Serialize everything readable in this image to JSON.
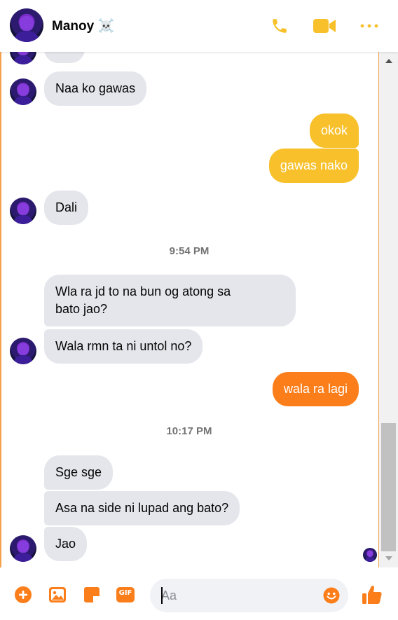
{
  "header": {
    "name": "Manoy ☠️",
    "call_icon": "phone-icon",
    "video_icon": "video-camera-icon",
    "more_icon": "more-options-icon"
  },
  "colors": {
    "accent_yellow": "#f8c02a",
    "accent_orange": "#fb7e1a",
    "incoming_bubble": "#e4e6eb"
  },
  "messages": {
    "m1": "Naa ko gawas",
    "m2": "okok",
    "m3": "gawas nako",
    "m4": "Dali",
    "t1": "9:54 PM",
    "m5_line1": "Wla ra jd to na bun og atong sa",
    "m5_line2": "bato jao?",
    "m6": "Wala rmn ta ni untol no?",
    "m7": "wala ra lagi",
    "t2": "10:17 PM",
    "m8": "Sge sge",
    "m9": "Asa na side ni lupad ang bato?",
    "m10": "Jao"
  },
  "composer": {
    "placeholder": "Aa",
    "add_icon": "plus-circle-icon",
    "image_icon": "image-icon",
    "sticker_icon": "sticker-icon",
    "gif_label": "GIF",
    "emoji_icon": "smile-emoji-icon",
    "like_icon": "thumbs-up-icon"
  }
}
